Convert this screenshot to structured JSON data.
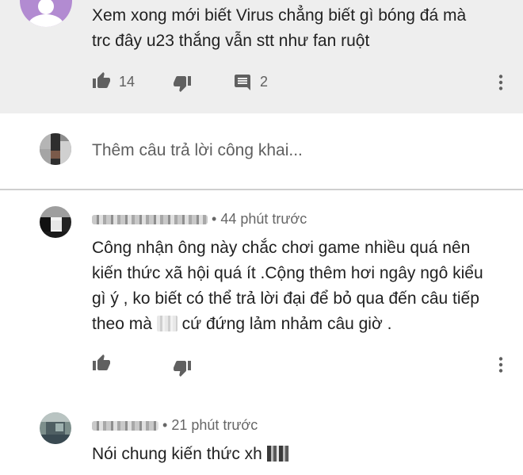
{
  "top_comment": {
    "text_line1": "Xem xong mới biết Virus chẳng biết gì bóng đá mà",
    "text_line2": "trc đây u23 thắng vẫn stt như fan ruột",
    "likes": "14",
    "replies": "2"
  },
  "reply_box": {
    "placeholder": "Thêm câu trả lời công khai..."
  },
  "replies": [
    {
      "meta": "• 44 phút trước",
      "text_lines": [
        "Công nhận ông này chắc chơi game nhiều quá nên",
        "kiến thức xã hội quá ít .Cộng thêm hơi ngây ngô kiểu",
        "gì ý , ko biết có thể trả lời đại để bỏ qua đến câu tiếp"
      ],
      "text_line4_a": "theo mà",
      "text_line4_b": "cứ đứng lảm nhảm câu giờ ."
    },
    {
      "meta": "• 21 phút trước",
      "text": "Nói chung kiến thức xh"
    }
  ],
  "icons": {
    "like": "thumb-up-icon",
    "dislike": "thumb-down-icon",
    "reply": "comment-icon",
    "more": "more-vert-icon"
  },
  "colors": {
    "highlight_bg": "#eeeeee",
    "icon_gray": "#606060",
    "avatar_purple": "#b28bd1"
  }
}
